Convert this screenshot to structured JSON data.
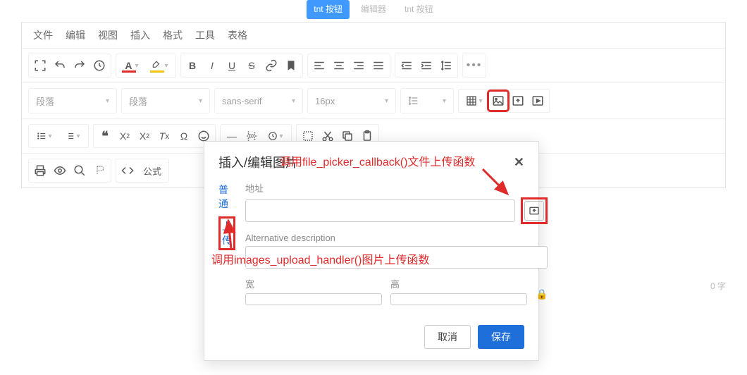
{
  "tabs_top": {
    "left": "tnt 按钮",
    "mid": "编辑器",
    "right": "tnt 按钮"
  },
  "menubar": [
    "文件",
    "编辑",
    "视图",
    "插入",
    "格式",
    "工具",
    "表格"
  ],
  "selects": {
    "block1": "段落",
    "block2": "段落",
    "font": "sans-serif",
    "size": "16px"
  },
  "toolbar_extra": "公式",
  "dialog": {
    "title": "插入/编辑图片",
    "tabs": {
      "general": "普通",
      "upload": "上传"
    },
    "labels": {
      "url": "地址",
      "alt": "Alternative description",
      "width": "宽",
      "height": "高"
    },
    "buttons": {
      "cancel": "取消",
      "save": "保存"
    }
  },
  "annotations": {
    "top": "调用file_picker_callback()文件上传函数",
    "bottom": "调用images_upload_handler()图片上传函数"
  },
  "status": "0 字"
}
